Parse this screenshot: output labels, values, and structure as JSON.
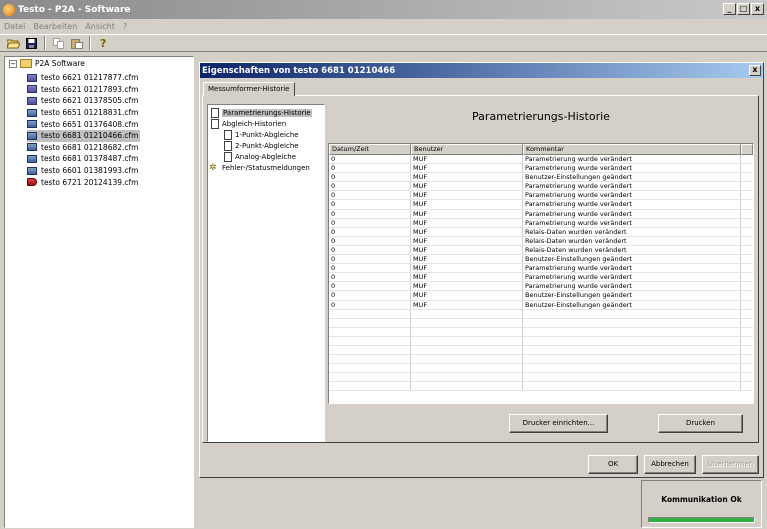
{
  "window": {
    "title": "Testo - P2A - Software",
    "controls": [
      "_",
      "□",
      "x"
    ]
  },
  "menu": [
    "Datei",
    "Bearbeiten",
    "Ansicht",
    "?"
  ],
  "toolbar": {
    "icons": [
      "open-folder-icon",
      "save-icon",
      "copy-icon",
      "paste-icon",
      "help-icon"
    ]
  },
  "tree": {
    "root_label": "P2A Software",
    "items": [
      {
        "label": "testo 6621  01217877.cfm",
        "icon": "meter"
      },
      {
        "label": "testo 6621  01217893.cfm",
        "icon": "meter"
      },
      {
        "label": "testo 6621  01378505.cfm",
        "icon": "meter"
      },
      {
        "label": "testo 6651  01218831.cfm",
        "icon": "tx"
      },
      {
        "label": "testo 6651  01376408.cfm",
        "icon": "tx"
      },
      {
        "label": "testo 6681  01210466.cfm",
        "icon": "tx",
        "selected": true
      },
      {
        "label": "testo 6681  01218682.cfm",
        "icon": "tx"
      },
      {
        "label": "testo 6681  01378487.cfm",
        "icon": "tx"
      },
      {
        "label": "testo 6601  01381993.cfm",
        "icon": "tx"
      },
      {
        "label": "testo 6721  20124139.cfm",
        "icon": "probe"
      }
    ]
  },
  "dialog": {
    "title": "Eigenschaften von testo 6681  01210466",
    "close_label": "x",
    "tab_label": "Messumformer-Historie",
    "nav": [
      {
        "label": "Parametrierungs-Historie"
      },
      {
        "label": "Abgleich-Historien"
      },
      {
        "label": "1-Punkt-Abgleiche"
      },
      {
        "label": "2-Punkt-Abgleiche"
      },
      {
        "label": "Analog-Abgleiche"
      },
      {
        "label": "Fehler-/Statusmeldungen"
      }
    ],
    "section_title": "Parametrierungs-Historie",
    "table": {
      "headers": [
        "Datum/Zeit",
        "Benutzer",
        "Kommentar"
      ],
      "rows": [
        [
          "0",
          "MUF",
          "Parametrierung wurde verändert"
        ],
        [
          "0",
          "MUF",
          "Parametrierung wurde verändert"
        ],
        [
          "0",
          "MUF",
          "Benutzer-Einstellungen geändert"
        ],
        [
          "0",
          "MUF",
          "Parametrierung wurde verändert"
        ],
        [
          "0",
          "MUF",
          "Parametrierung wurde verändert"
        ],
        [
          "0",
          "MUF",
          "Parametrierung wurde verändert"
        ],
        [
          "0",
          "MUF",
          "Parametrierung wurde verändert"
        ],
        [
          "0",
          "MUF",
          "Parametrierung wurde verändert"
        ],
        [
          "0",
          "MUF",
          "Relais-Daten wurden verändert"
        ],
        [
          "0",
          "MUF",
          "Relais-Daten wurden verändert"
        ],
        [
          "0",
          "MUF",
          "Relais-Daten wurden verändert"
        ],
        [
          "0",
          "MUF",
          "Benutzer-Einstellungen geändert"
        ],
        [
          "0",
          "MUF",
          "Parametrierung wurde verändert"
        ],
        [
          "0",
          "MUF",
          "Parametrierung wurde verändert"
        ],
        [
          "0",
          "MUF",
          "Parametrierung wurde verändert"
        ],
        [
          "0",
          "MUF",
          "Benutzer-Einstellungen geändert"
        ],
        [
          "0",
          "MUF",
          "Benutzer-Einstellungen geändert"
        ]
      ],
      "empty_rows": 9
    },
    "printer_setup_label": "Drucker einrichten...",
    "print_label": "Drucken",
    "ok_label": "OK",
    "cancel_label": "Abbrechen",
    "apply_label": "Übernehmen"
  },
  "status": {
    "text": "Kommunikation Ok",
    "color": "#30b040"
  }
}
